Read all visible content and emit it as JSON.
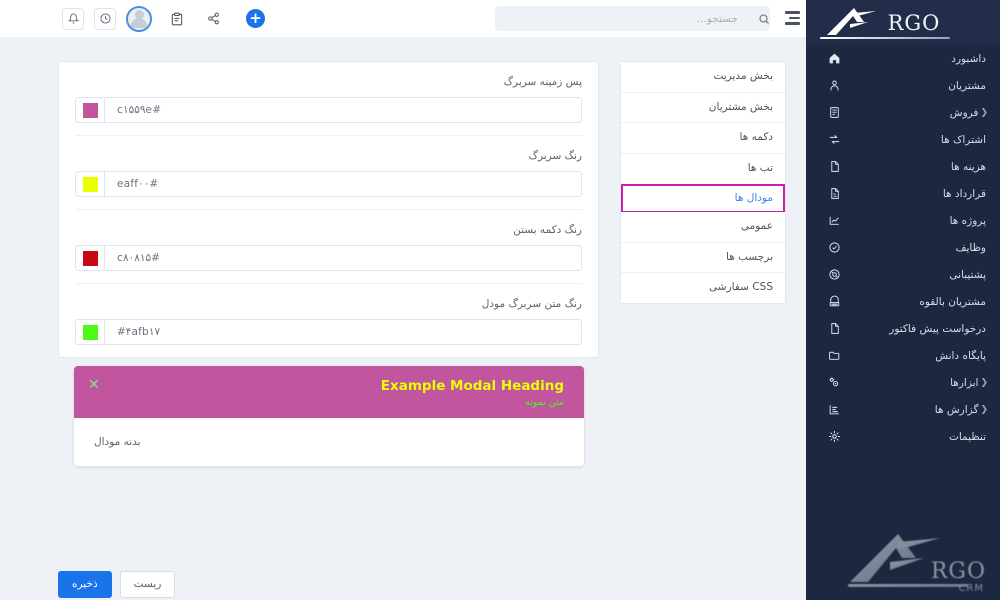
{
  "topbar": {
    "icons": [
      {
        "name": "bell-icon",
        "label": "اعلان ها"
      },
      {
        "name": "clock-icon",
        "label": "تاریخچه"
      }
    ],
    "avatar_label": "پروفایل کاربر",
    "clipboard_label": "یادداشت ها",
    "share_label": "اشتراک گذاری",
    "add_label": "+",
    "menu_toggle_label": "منو"
  },
  "search": {
    "placeholder": "جستجو...",
    "value": "",
    "icon": "search-icon"
  },
  "settings_menu": {
    "items": [
      {
        "label": "بخش مدیریت",
        "active": false
      },
      {
        "label": "بخش مشتریان",
        "active": false
      },
      {
        "label": "دکمه ها",
        "active": false
      },
      {
        "label": "تب ها",
        "active": false
      },
      {
        "label": "مودال ها",
        "active": true
      },
      {
        "label": "عمومی",
        "active": false
      },
      {
        "label": "برچسب ها",
        "active": false
      },
      {
        "label": "CSS سفارشی",
        "active": false
      }
    ],
    "active_border_color": "#cb1fb2",
    "active_text_color": "#3b82f6"
  },
  "form": {
    "fields": [
      {
        "label": "پس زمینه سربرگ",
        "value_display": "#c۱۵۵۹e",
        "color": "#c1559e",
        "name": "modal-header-background"
      },
      {
        "label": "رنگ سربرگ",
        "value_display": "#eaff۰۰",
        "color": "#eaff00",
        "name": "modal-header-color"
      },
      {
        "label": "رنگ دکمه بستن",
        "value_display": "#c۸۰۸۱۵",
        "color": "#c80815",
        "name": "modal-close-button-color"
      },
      {
        "label": "رنگ متن سربرگ مودل",
        "value_display": "#۴afb۱۷",
        "color": "#4afb17",
        "name": "modal-header-text-color"
      }
    ]
  },
  "modal_preview": {
    "heading": "Example Modal Heading",
    "subtitle": "متن نمونه",
    "body": "بدنه مودال",
    "close_icon": "✕",
    "header_bg": "#c1559e",
    "heading_color": "#eaff00",
    "subtitle_color": "#4afb17",
    "close_color": "#7ee87a"
  },
  "footer": {
    "save_label": "ذخیره",
    "reset_label": "ریست"
  },
  "sidebar": {
    "brand": "RGO",
    "items": [
      {
        "label": "داشبورد",
        "icon": "home-icon",
        "caret": false
      },
      {
        "label": "مشتریان",
        "icon": "user-icon",
        "caret": false
      },
      {
        "label": "فروش",
        "icon": "receipt-icon",
        "caret": true
      },
      {
        "label": "اشتراک ها",
        "icon": "refresh-icon",
        "caret": false
      },
      {
        "label": "هزینه ها",
        "icon": "document-icon",
        "caret": false
      },
      {
        "label": "قرارداد ها",
        "icon": "contract-icon",
        "caret": false
      },
      {
        "label": "پروژه ها",
        "icon": "chart-icon",
        "caret": false
      },
      {
        "label": "وظایف",
        "icon": "check-circle-icon",
        "caret": false
      },
      {
        "label": "پشتیبانی",
        "icon": "lifebuoy-icon",
        "caret": false
      },
      {
        "label": "مشتریان بالقوه",
        "icon": "megaphone-icon",
        "caret": false
      },
      {
        "label": "درخواست پیش فاکتور",
        "icon": "file-icon",
        "caret": false
      },
      {
        "label": "پایگاه دانش",
        "icon": "folder-icon",
        "caret": false
      },
      {
        "label": "ابزارها",
        "icon": "gears-icon",
        "caret": true
      },
      {
        "label": "گزارش ها",
        "icon": "bar-chart-icon",
        "caret": true
      },
      {
        "label": "تنظیمات",
        "icon": "gear-icon",
        "caret": false
      }
    ],
    "watermark_brand": "RGO",
    "watermark_sub": "CRM",
    "background": "#1c2740"
  }
}
